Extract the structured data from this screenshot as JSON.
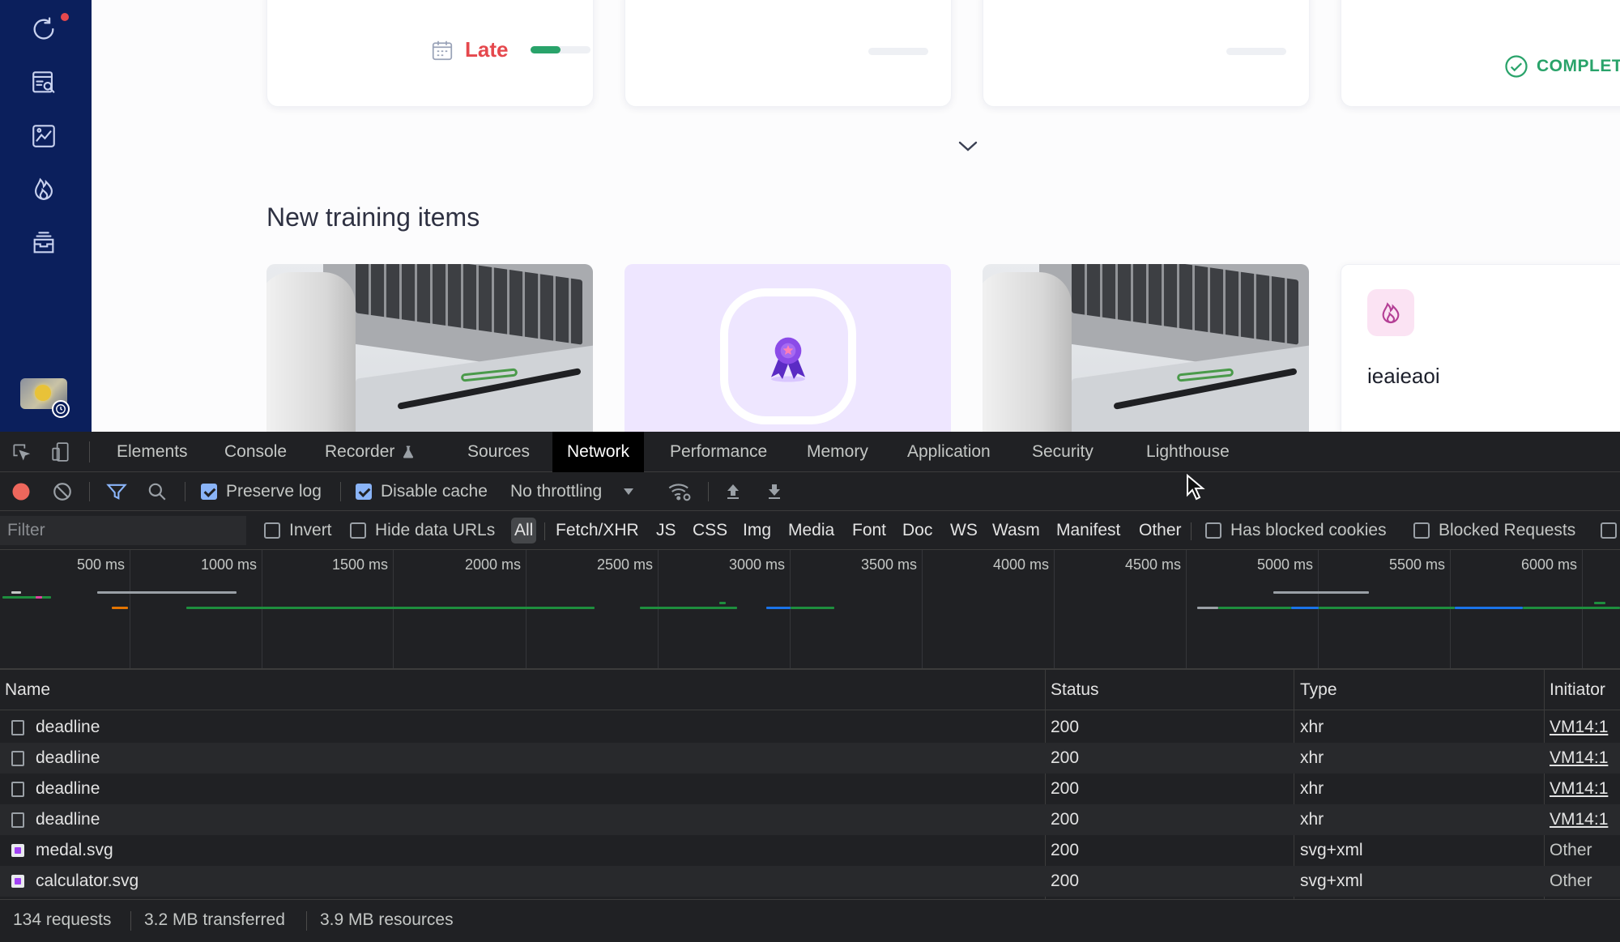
{
  "sidebar": {
    "icons": [
      "refresh-icon",
      "search-document-icon",
      "report-icon",
      "fire-icon",
      "archive-icon"
    ],
    "has_notification": true
  },
  "deadlines": {
    "late_label": "Late",
    "late_progress": 0.5,
    "complete_label": "COMPLET"
  },
  "training": {
    "section_title": "New training items",
    "cards": [
      {
        "kind": "photo"
      },
      {
        "kind": "medal"
      },
      {
        "kind": "photo"
      },
      {
        "kind": "text",
        "title": "ieaieaoi"
      }
    ]
  },
  "devtools": {
    "tabs": [
      "Elements",
      "Console",
      "Recorder",
      "Sources",
      "Network",
      "Performance",
      "Memory",
      "Application",
      "Security",
      "Lighthouse"
    ],
    "active_tab": "Network",
    "toolbar": {
      "preserve_log_label": "Preserve log",
      "preserve_log_checked": true,
      "disable_cache_label": "Disable cache",
      "disable_cache_checked": true,
      "throttling_value": "No throttling"
    },
    "filter": {
      "placeholder": "Filter",
      "invert_label": "Invert",
      "hide_data_urls_label": "Hide data URLs",
      "types": [
        "All",
        "Fetch/XHR",
        "JS",
        "CSS",
        "Img",
        "Media",
        "Font",
        "Doc",
        "WS",
        "Wasm",
        "Manifest",
        "Other"
      ],
      "active_type": "All",
      "has_blocked_cookies_label": "Has blocked cookies",
      "blocked_requests_label": "Blocked Requests"
    },
    "timeline": {
      "ticks": [
        "500 ms",
        "1000 ms",
        "1500 ms",
        "2000 ms",
        "2500 ms",
        "3000 ms",
        "3500 ms",
        "4000 ms",
        "4500 ms",
        "5000 ms",
        "5500 ms",
        "6000 ms"
      ]
    },
    "table": {
      "columns": [
        "Name",
        "Status",
        "Type",
        "Initiator"
      ],
      "rows": [
        {
          "name": "deadline",
          "status": "200",
          "type": "xhr",
          "initiator": "VM14:1",
          "icon": "file-icon"
        },
        {
          "name": "deadline",
          "status": "200",
          "type": "xhr",
          "initiator": "VM14:1",
          "icon": "file-icon"
        },
        {
          "name": "deadline",
          "status": "200",
          "type": "xhr",
          "initiator": "VM14:1",
          "icon": "file-icon"
        },
        {
          "name": "deadline",
          "status": "200",
          "type": "xhr",
          "initiator": "VM14:1",
          "icon": "file-icon"
        },
        {
          "name": "medal.svg",
          "status": "200",
          "type": "svg+xml",
          "initiator": "Other",
          "icon": "image-icon"
        },
        {
          "name": "calculator.svg",
          "status": "200",
          "type": "svg+xml",
          "initiator": "Other",
          "icon": "image-icon"
        }
      ]
    },
    "status": {
      "requests": "134 requests",
      "transferred": "3.2 MB transferred",
      "resources": "3.9 MB resources"
    }
  },
  "colors": {
    "sidebar_bg": "#0b1f5c",
    "late_red": "#e5484d",
    "complete_green": "#29a36a",
    "devtools_bg": "#202124",
    "accent_blue": "#8ab4f8"
  }
}
